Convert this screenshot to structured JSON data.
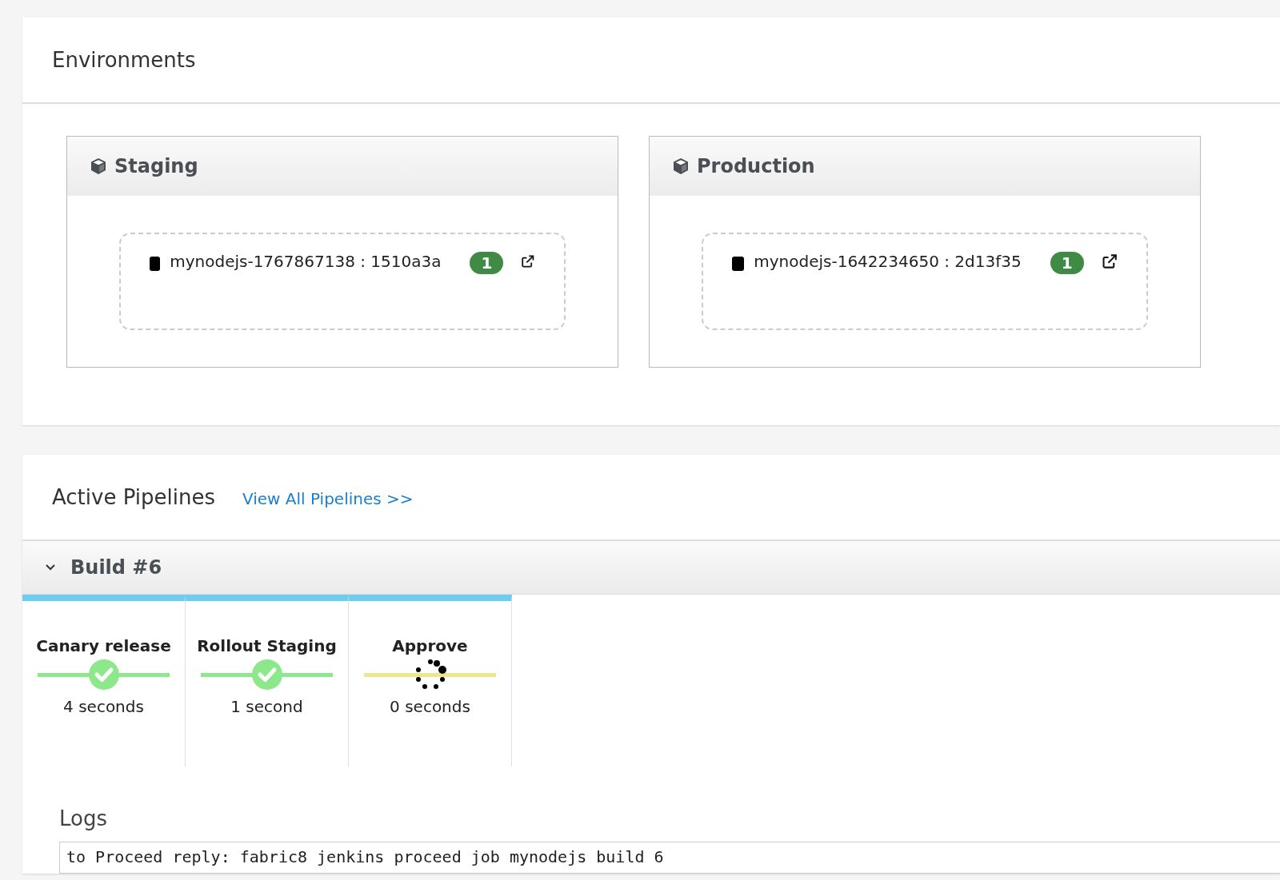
{
  "environments": {
    "title": "Environments",
    "items": [
      {
        "name": "Staging",
        "apps": [
          {
            "label": "mynodejs-1767867138 : 1510a3a",
            "pods": "1"
          }
        ]
      },
      {
        "name": "Production",
        "apps": [
          {
            "label": "mynodejs-1642234650 : 2d13f35",
            "pods": "1"
          }
        ]
      }
    ]
  },
  "pipelines": {
    "title": "Active Pipelines",
    "link": "View All Pipelines >>",
    "build": {
      "title": "Build #6",
      "expanded": true,
      "stages": [
        {
          "name": "Canary release",
          "kind": "success",
          "duration": "4 seconds"
        },
        {
          "name": "Rollout Staging",
          "kind": "success",
          "duration": "1 second"
        },
        {
          "name": "Approve",
          "kind": "running",
          "duration": "0 seconds"
        }
      ]
    },
    "logs": {
      "title": "Logs",
      "text": "to Proceed reply: fabric8 jenkins proceed job mynodejs build 6"
    }
  }
}
